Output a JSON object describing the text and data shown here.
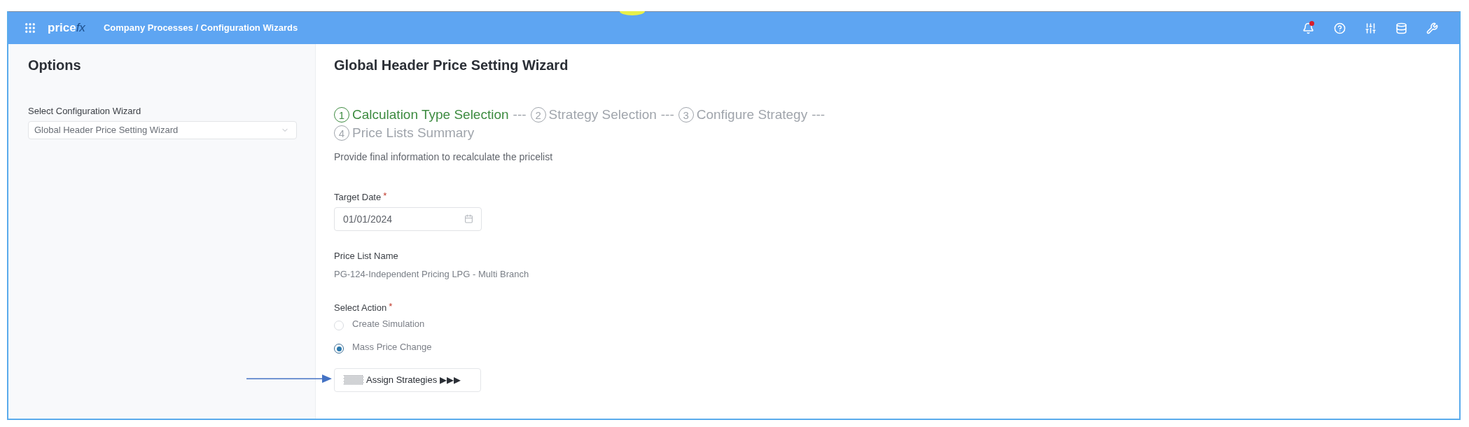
{
  "header": {
    "logo": {
      "main": "price",
      "accent": "fx"
    },
    "breadcrumb": "Company Processes / Configuration Wizards",
    "has_notifications": true
  },
  "sidebar": {
    "title": "Options",
    "field": {
      "label": "Select Configuration Wizard",
      "value": "Global Header Price Setting Wizard"
    }
  },
  "main": {
    "title": "Global Header Price Setting Wizard",
    "steps": [
      {
        "number": "1",
        "label": "Calculation Type Selection",
        "selected": true,
        "separator": "---"
      },
      {
        "number": "2",
        "label": "Strategy Selection",
        "selected": false,
        "separator": "---"
      },
      {
        "number": "3",
        "label": "Configure Strategy",
        "selected": false,
        "separator": "---"
      },
      {
        "number": "4",
        "label": "Price Lists Summary",
        "selected": false
      }
    ],
    "description": "Provide final information to recalculate the pricelist",
    "target_date": {
      "label": "Target Date",
      "required_mark": "*",
      "value": "01/01/2024"
    },
    "price_list_name": {
      "label": "Price List Name",
      "value": "PG-124-Independent Pricing LPG - Multi Branch"
    },
    "select_action": {
      "label": "Select Action",
      "required_mark": "*",
      "options": [
        {
          "label": "Create Simulation",
          "selected": false
        },
        {
          "label": "Mass Price Change",
          "selected": true
        }
      ]
    },
    "assign_button": {
      "label": "Assign Strategies ▶▶▶"
    }
  }
}
